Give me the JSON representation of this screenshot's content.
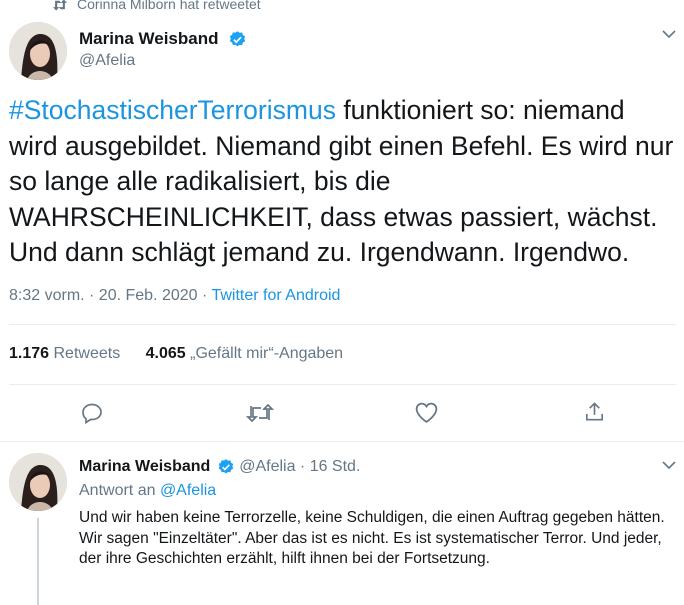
{
  "retweet_context": {
    "text": "Corinna Milborn hat retweetet"
  },
  "main_tweet": {
    "author_name": "Marina Weisband",
    "handle": "@Afelia",
    "hashtag": "#StochastischerTerrorismus",
    "text_rest": " funktioniert so: niemand wird ausgebildet. Niemand gibt einen Befehl. Es wird nur so lange alle radikalisiert, bis die WAHRSCHEINLICHKEIT, dass etwas passiert, wächst. Und dann schlägt jemand zu. Irgendwann. Irgendwo.",
    "timestamp": "8:32 vorm. · 20. Feb. 2020 · ",
    "source": "Twitter for Android",
    "retweets_count": "1.176",
    "retweets_label": " Retweets",
    "likes_count": "4.065",
    "likes_label": " „Gefällt mir“-Angaben"
  },
  "reply_tweet": {
    "author_name": "Marina Weisband",
    "handle": "@Afelia",
    "time": " · 16 Std.",
    "reply_to_label": "Antwort an ",
    "reply_to_handle": "@Afelia",
    "text": "Und wir haben keine Terrorzelle, keine Schuldigen, die einen Auftrag gegeben hätten. Wir sagen \"Einzeltäter\". Aber das ist es nicht. Es ist systematischer Terror. Und jeder, der ihre Geschichten erzählt, hilft ihnen bei der Fortsetzung."
  },
  "icons": {
    "retweet": "retweet-icon",
    "verified": "verified-badge-icon",
    "reply": "reply-icon",
    "like": "like-icon",
    "share": "share-icon",
    "caret": "chevron-down-icon"
  },
  "colors": {
    "accent": "#1b95e0",
    "muted": "#657786",
    "text": "#14171a",
    "divider": "#e6ecf0"
  }
}
